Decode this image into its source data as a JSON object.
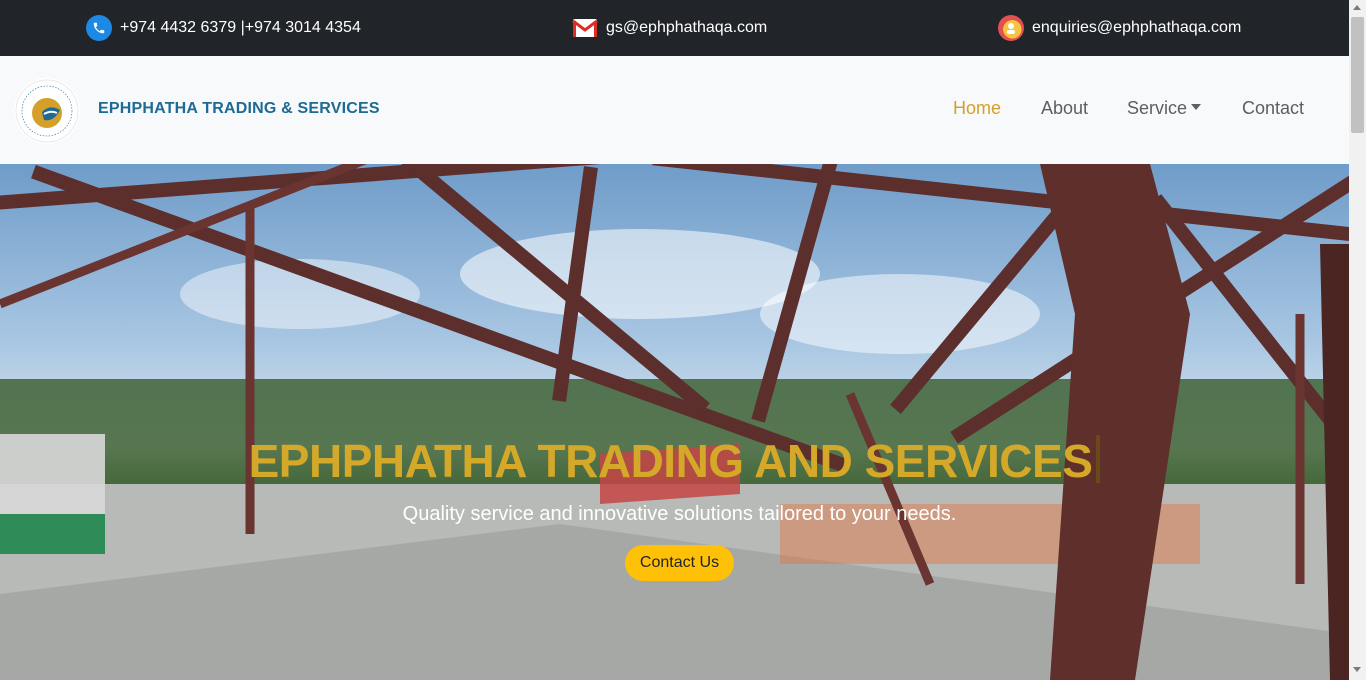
{
  "topbar": {
    "phone": "+974 4432 6379 |+974 3014 4354",
    "email": "gs@ephphathaqa.com",
    "enquiries": "enquiries@ephphathaqa.com",
    "icons": [
      "phone-icon",
      "mail-icon",
      "enquiries-icon"
    ]
  },
  "navbar": {
    "brand": "EPHPHATHA TRADING & SERVICES",
    "links": [
      {
        "label": "Home",
        "active": true
      },
      {
        "label": "About"
      },
      {
        "label": "Service",
        "dropdown": true
      },
      {
        "label": "Contact"
      }
    ]
  },
  "hero": {
    "title": "EPHPHATHA TRADING AND SERVICES",
    "subtitle": "Quality service and innovative solutions tailored to your needs.",
    "cta_label": "Contact Us"
  },
  "colors": {
    "topbar_bg": "#212529",
    "brand": "#1d6a94",
    "accent": "#d4a02a",
    "cta": "#ffc107"
  }
}
